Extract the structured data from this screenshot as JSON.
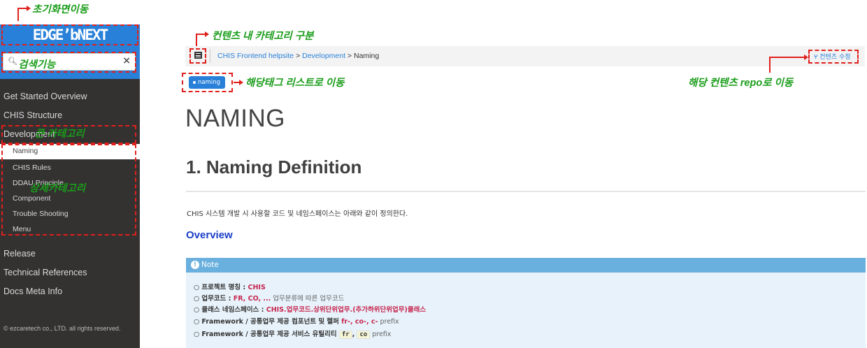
{
  "annotations": {
    "home": "초기화면이동",
    "search": "검색기능",
    "category_inside": "컨텐츠 내 카테고리 구분",
    "tag_list": "해당태그 리스트로 이동",
    "repo": "해당 컨텐츠 repo로 이동",
    "big_category": "큰 카테고리",
    "detail_category": "상세카테고리"
  },
  "sidebar": {
    "logo": "EDGE’bNEXT",
    "search_value": "",
    "search_clear": "×",
    "items": [
      {
        "label": "Get Started Overview",
        "level": 1
      },
      {
        "label": "CHIS Structure",
        "level": 1
      },
      {
        "label": "Development",
        "level": 1
      },
      {
        "label": "Naming",
        "level": 2,
        "active": true
      },
      {
        "label": "CHIS Rules",
        "level": 2
      },
      {
        "label": "DDAU Principle",
        "level": 2
      },
      {
        "label": "Component",
        "level": 2
      },
      {
        "label": "Trouble Shooting",
        "level": 2
      },
      {
        "label": "Menu",
        "level": 2
      },
      {
        "label": "Release",
        "level": 1
      },
      {
        "label": "Technical References",
        "level": 1
      },
      {
        "label": "Docs Meta Info",
        "level": 1
      }
    ],
    "footer": "© ezcaretech co., LTD. all rights reserved."
  },
  "breadcrumb": {
    "home": "CHIS Frontend helpsite",
    "sep1": ">",
    "section": "Development",
    "sep2": ">",
    "current": "Naming"
  },
  "edit_link": "컨텐츠 수정",
  "tag": "naming",
  "page": {
    "title": "NAMING",
    "h2": "1. Naming Definition",
    "para": "CHIS 시스템 개발 시 사용할 코드 및 네임스페이스는 아래와 같이 정의한다.",
    "h3": "Overview"
  },
  "note": {
    "head": "Note",
    "rows": [
      {
        "bullet": "○",
        "label": "프로젝트 명칭 : ",
        "value": "CHIS",
        "rest": ""
      },
      {
        "bullet": "○",
        "label": "업무코드 : ",
        "value": "FR, CO, ...",
        "rest": " 업무분류에 따른 업무코드"
      },
      {
        "bullet": "○",
        "label": "클래스 네임스페이스 : ",
        "value": "CHIS.업무코드.상위단위업무.(추가하위단위업무)클래스",
        "rest": ""
      },
      {
        "bullet": "○",
        "label": "Framework / 공통업무 제공 컴포넌트 및 헬퍼 ",
        "value": "fr-, co-, c-",
        "rest": " prefix"
      },
      {
        "bullet": "○",
        "label": "Framework / 공통업무 제공 서비스 유틸리티 ",
        "code1": "fr",
        "mid": ",",
        "code2": "co",
        "rest": " prefix"
      }
    ]
  }
}
